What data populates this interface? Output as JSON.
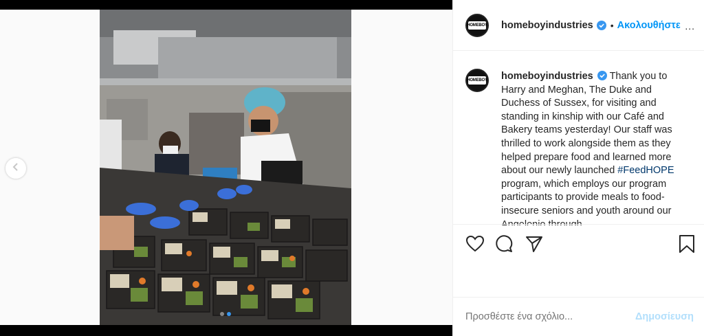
{
  "post": {
    "username": "homeboyindustries",
    "follow_label": "Ακολουθήστε",
    "separator": "•",
    "more_label": "...",
    "avatar_text": "HOMEBOY",
    "caption_parts": {
      "body_1": "Thank you to Harry and Meghan, The Duke and Duchess of Sussex, for visiting and standing in kinship with our Café and Bakery teams yesterday! Our staff was thrilled to work alongside them as they helped prepare food and learned more about our newly launched ",
      "hashtag": "#FeedHOPE",
      "body_2": " program, which employs our program participants to provide meals to food-insecure seniors and youth around our Angelenio through"
    },
    "comment_placeholder": "Προσθέστε ένα σχόλιο...",
    "post_label": "Δημοσίευση"
  },
  "carousel": {
    "slide_count": 2,
    "active_index": 0
  },
  "colors": {
    "accent": "#0095f6",
    "verified": "#3897f0"
  },
  "icons": [
    "chevron-left-icon",
    "heart-icon",
    "comment-icon",
    "share-icon",
    "bookmark-icon",
    "verified-badge-icon"
  ]
}
